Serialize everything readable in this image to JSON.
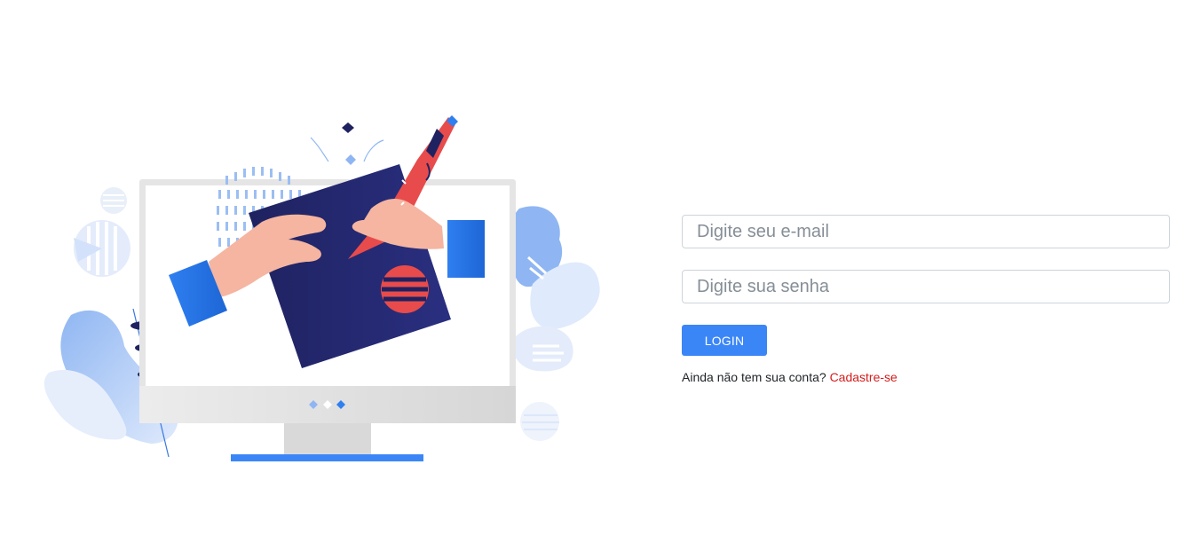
{
  "login": {
    "email_placeholder": "Digite seu e-mail",
    "password_placeholder": "Digite sua senha",
    "button_label": "LOGIN",
    "signup_prompt": "Ainda não tem sua conta?",
    "signup_link": "Cadastre-se"
  },
  "colors": {
    "primary": "#3b86f7",
    "link": "#d41c1c",
    "dark_navy": "#1f2260"
  },
  "icons": {
    "illustration": "monitor-drawing-illustration"
  }
}
